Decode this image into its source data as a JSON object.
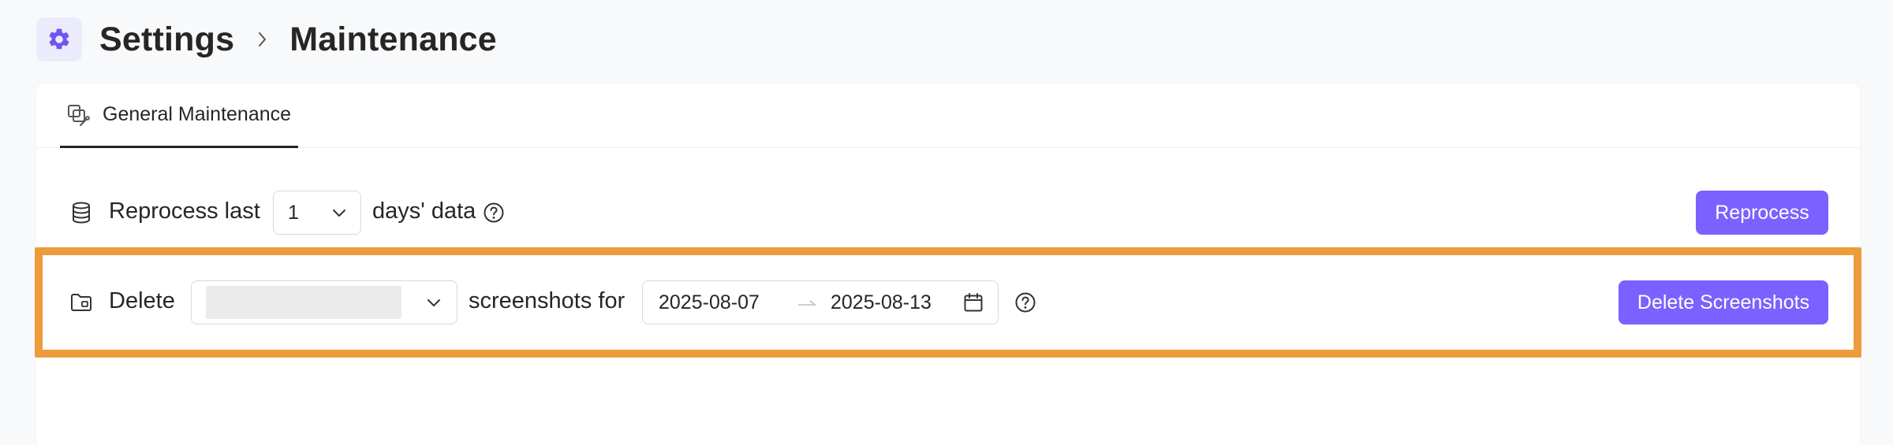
{
  "header": {
    "title": "Settings",
    "current_page": "Maintenance"
  },
  "tabs": [
    {
      "label": "General Maintenance",
      "active": true
    }
  ],
  "reprocess": {
    "prefix": "Reprocess last",
    "days_value": "1",
    "suffix": "days' data",
    "button_label": "Reprocess"
  },
  "delete": {
    "prefix": "Delete",
    "selected_value": "",
    "middle_text": "screenshots for",
    "start_date": "2025-08-07",
    "end_date": "2025-08-13",
    "button_label": "Delete Screenshots"
  },
  "colors": {
    "accent": "#7b61ff",
    "highlight": "#ee9b3c",
    "badge_bg": "#ecebfb"
  },
  "icons": {
    "header": "gear-icon",
    "tab": "maintenance-tools-icon",
    "reprocess": "database-icon",
    "delete": "folder-icon",
    "help": "question-circle-icon",
    "calendar": "calendar-icon"
  }
}
